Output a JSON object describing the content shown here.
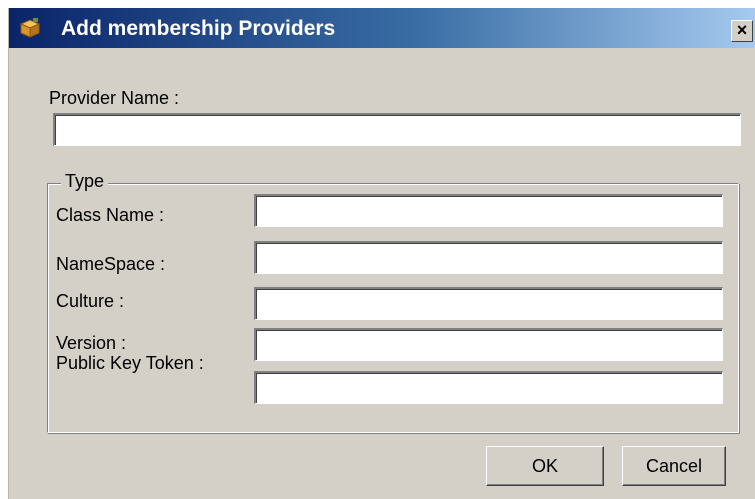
{
  "window": {
    "title": "Add membership Providers",
    "icon": "provider-cube-icon",
    "close_glyph": "×"
  },
  "provider_name": {
    "label": "Provider Name :",
    "value": ""
  },
  "type_group": {
    "legend": "Type",
    "fields": [
      {
        "label": "Class Name :",
        "value": ""
      },
      {
        "label": "NameSpace :",
        "value": ""
      },
      {
        "label": "Culture :",
        "value": ""
      },
      {
        "label": "Version :",
        "value": ""
      },
      {
        "label": "Public Key Token :",
        "value": ""
      }
    ]
  },
  "buttons": {
    "ok": "OK",
    "cancel": "Cancel"
  },
  "colors": {
    "titlebar_start": "#0a246a",
    "titlebar_end": "#a6caf0",
    "face": "#d4d0c8"
  }
}
